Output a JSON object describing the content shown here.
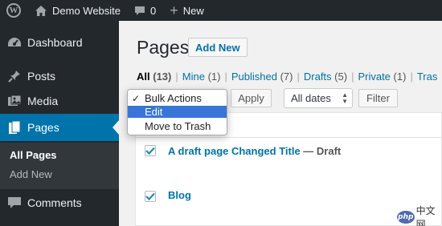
{
  "adminbar": {
    "logo_glyph": "W",
    "site_name": "Demo Website",
    "comments_count": "0",
    "new_label": "New"
  },
  "sidebar": {
    "items": [
      {
        "label": "Dashboard",
        "icon": "dashboard-icon"
      },
      {
        "label": "Posts",
        "icon": "pushpin-icon"
      },
      {
        "label": "Media",
        "icon": "media-icon"
      },
      {
        "label": "Pages",
        "icon": "pages-icon"
      },
      {
        "label": "Comments",
        "icon": "comment-icon"
      }
    ],
    "submenu": [
      {
        "label": "All Pages"
      },
      {
        "label": "Add New"
      }
    ]
  },
  "main": {
    "title": "Pages",
    "add_new_label": "Add New",
    "filters": [
      {
        "label": "All",
        "count": "(13)"
      },
      {
        "label": "Mine",
        "count": "(1)"
      },
      {
        "label": "Published",
        "count": "(7)"
      },
      {
        "label": "Drafts",
        "count": "(5)"
      },
      {
        "label": "Private",
        "count": "(1)"
      },
      {
        "label": "Tras",
        "count": ""
      }
    ],
    "apply_label": "Apply",
    "dates_value": "All dates",
    "filter_label": "Filter",
    "bulk_actions": {
      "options": [
        "Bulk Actions",
        "Edit",
        "Move to Trash"
      ],
      "selected": "Bulk Actions",
      "highlighted": "Edit",
      "check_glyph": "✓"
    },
    "rows": [
      {
        "title": "A draft page Changed Title",
        "state": " — Draft",
        "checked": true
      },
      {
        "title": "Blog",
        "state": "",
        "checked": true
      }
    ]
  },
  "watermark": {
    "logo_text": "php",
    "text": "中文网"
  },
  "colors": {
    "accent": "#0073aa",
    "adminbar": "#23282d",
    "highlight": "#3875d7"
  }
}
